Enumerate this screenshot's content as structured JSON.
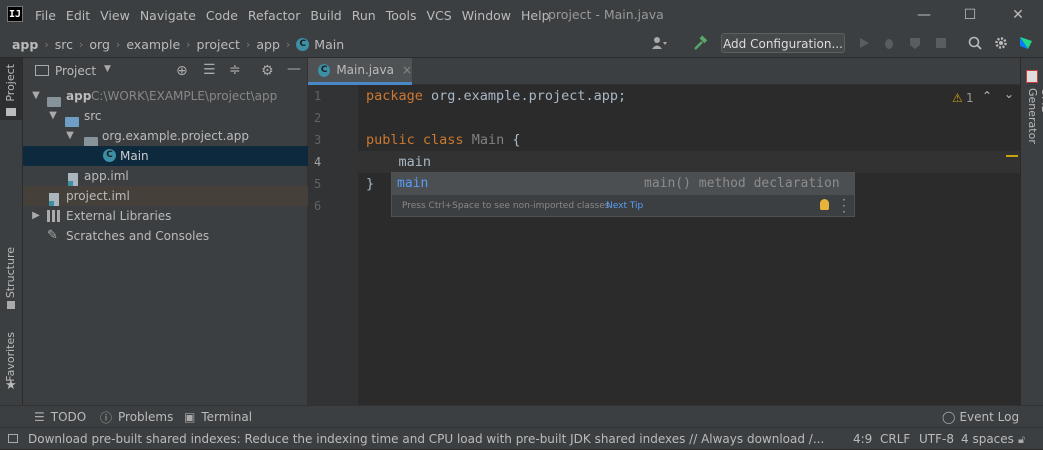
{
  "app": {
    "logo_text": "IJ",
    "window_title": "project - Main.java"
  },
  "menu": [
    "File",
    "Edit",
    "View",
    "Navigate",
    "Code",
    "Refactor",
    "Build",
    "Run",
    "Tools",
    "VCS",
    "Window",
    "Help"
  ],
  "window_controls": {
    "minimize": "—",
    "maximize": "☐",
    "close": "✕"
  },
  "breadcrumb": [
    "app",
    "src",
    "org",
    "example",
    "project",
    "app",
    "Main"
  ],
  "toolbar": {
    "run_config_label": "Add Configuration...",
    "icons": [
      "user-icon",
      "hammer-icon",
      "run-icon",
      "debug-icon",
      "coverage-icon",
      "stop-icon",
      "search-icon",
      "gear-icon",
      "jetbrains-icon"
    ]
  },
  "left_stripe": {
    "project": "Project",
    "structure": "Structure",
    "favorites": "Favorites"
  },
  "right_stripe": {
    "uml": "UML Generator"
  },
  "project_panel": {
    "title": "Project",
    "tree": [
      {
        "label": "app",
        "extra": "C:\\WORK\\EXAMPLE\\project\\app",
        "icon": "folder",
        "arrow": "down"
      },
      {
        "label": "src",
        "icon": "folder-blue",
        "arrow": "down"
      },
      {
        "label": "org.example.project.app",
        "icon": "package",
        "arrow": "down"
      },
      {
        "label": "Main",
        "icon": "class"
      },
      {
        "label": "app.iml",
        "icon": "iml-file"
      },
      {
        "label": "project.iml",
        "icon": "iml-file"
      },
      {
        "label": "External Libraries",
        "icon": "library",
        "arrow": "right"
      },
      {
        "label": "Scratches and Consoles",
        "icon": "scratches"
      }
    ]
  },
  "editor": {
    "tab_label": "Main.java",
    "tab_close": "×",
    "line_numbers": [
      "1",
      "2",
      "3",
      "4",
      "5",
      "6"
    ],
    "lines": {
      "l1_kw": "package",
      "l1_rest": " org.example.project.app;",
      "l3_kw1": "public",
      "l3_kw2": "class",
      "l3_cls": "Main",
      "l3_brace": " {",
      "l4": "    main",
      "l5": "}"
    },
    "inspection": {
      "count": "1",
      "warn": "⚠"
    }
  },
  "completion": {
    "item_name": "main",
    "item_desc": "main() method declaration",
    "hint": "Press Ctrl+Space to see non-imported classes",
    "next_tip": "Next Tip"
  },
  "bottom_tabs": {
    "todo": "TODO",
    "problems": "Problems",
    "terminal": "Terminal",
    "event_log": "Event Log"
  },
  "status": {
    "message": "Download pre-built shared indexes: Reduce the indexing time and CPU load with pre-built JDK shared indexes // Always download /... (8 minutes ago)",
    "position": "4:9",
    "line_sep": "CRLF",
    "encoding": "UTF-8",
    "indent": "4 spaces"
  },
  "colors": {
    "accent": "#4a88c7",
    "selection": "#0d293e",
    "keyword": "#cc7832",
    "link": "#589df6"
  }
}
